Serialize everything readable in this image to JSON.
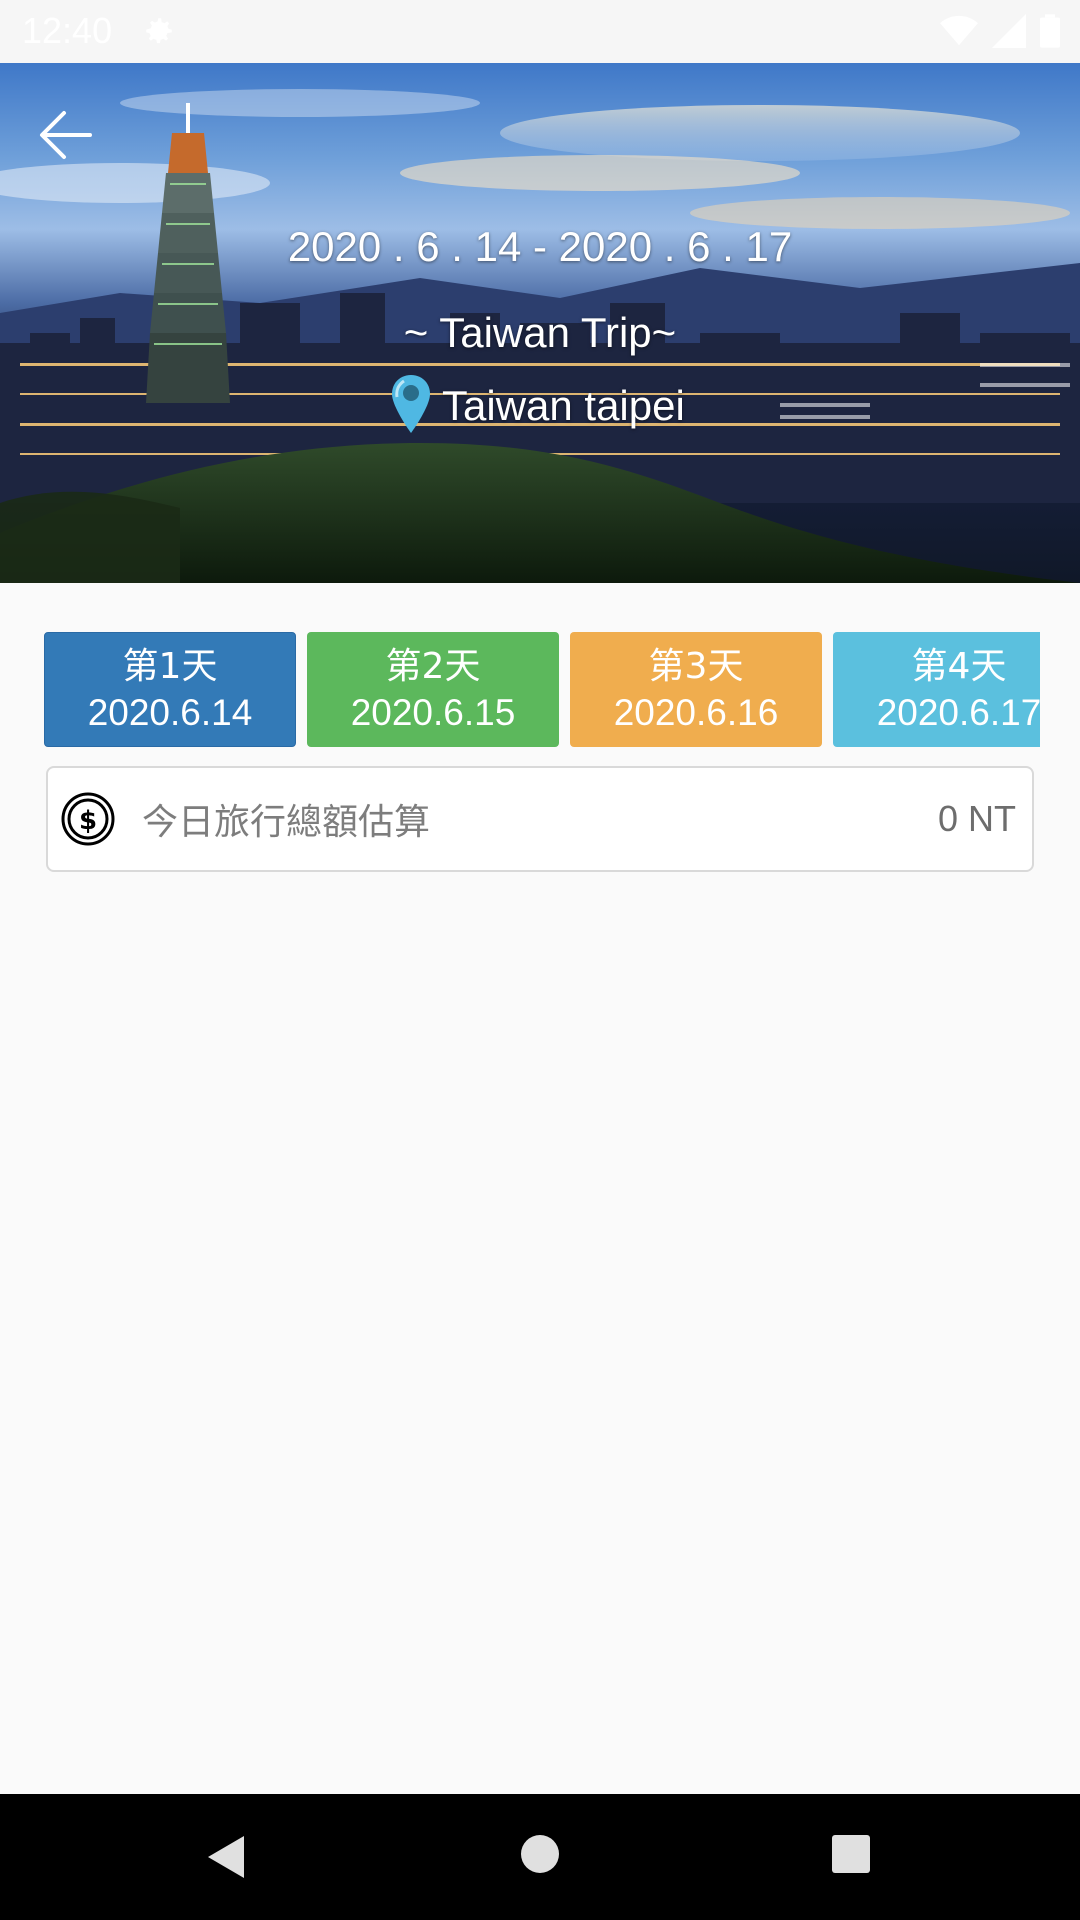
{
  "status_bar": {
    "time": "12:40"
  },
  "hero": {
    "dates": "2020 . 6 . 14 - 2020 . 6 . 17",
    "title": "~ Taiwan Trip~",
    "location": "Taiwan taipei"
  },
  "day_tabs": [
    {
      "label": "第1天",
      "date": "2020.6.14",
      "color": "#337ab7"
    },
    {
      "label": "第2天",
      "date": "2020.6.15",
      "color": "#5cb85c"
    },
    {
      "label": "第3天",
      "date": "2020.6.16",
      "color": "#f0ad4e"
    },
    {
      "label": "第4天",
      "date": "2020.6.17",
      "color": "#5bc0de"
    }
  ],
  "budget": {
    "label": "今日旅行總額估算",
    "value": "0 NT"
  },
  "icons": {
    "back": "arrow-left-icon",
    "settings": "gear-icon",
    "location": "map-pin-icon",
    "currency": "dollar-circle-icon",
    "wifi": "wifi-icon",
    "signal": "signal-icon",
    "battery": "battery-icon"
  }
}
